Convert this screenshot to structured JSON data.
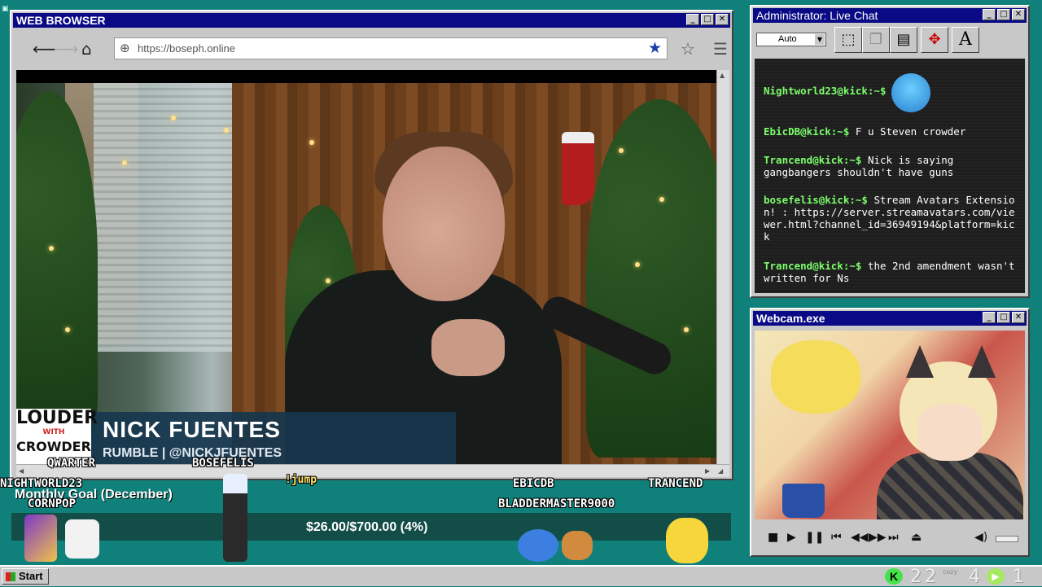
{
  "browser": {
    "title": "WEB BROWSER",
    "url": "https://boseph.online",
    "window_buttons": [
      "_",
      "□",
      "✕"
    ]
  },
  "video": {
    "lower_third_logo": "LOUDER",
    "lower_third_logo_sub": "WITH",
    "lower_third_logo_line2": "CROWDER",
    "name": "NICK FUENTES",
    "sub": "RUMBLE | @NICKJFUENTES"
  },
  "overlay": {
    "avatars": [
      "QWARTER",
      "BOSEFELIS",
      "NIGHTWORLD23",
      "CORNPOP",
      "EBICDB",
      "BLADDERMASTER9000",
      "TRANCEND"
    ],
    "jump_label": "!jump",
    "goal_title": "Monthly Goal (December)",
    "goal_text": "$26.00/$700.00 (4%)",
    "goal_progress": 0.04
  },
  "chat": {
    "title": "Administrator: Live Chat",
    "zoom_select": "Auto",
    "toolbar_font_icon": "A",
    "messages": [
      {
        "user": "Nightworld23@kick:~$",
        "text": ""
      },
      {
        "user": "EbicDB@kick:~$",
        "text": "F u Steven crowder"
      },
      {
        "user": "Trancend@kick:~$",
        "text": "Nick is saying gangbangers shouldn't have guns"
      },
      {
        "user": "bosefelis@kick:~$",
        "text": "Stream Avatars Extension! : https://server.streamavatars.com/viewer.html?channel_id=36949194&platform=kick"
      },
      {
        "user": "Trancend@kick:~$",
        "text": "the 2nd amendment wasn't written for Ns"
      }
    ]
  },
  "webcam": {
    "title": "Webcam.exe"
  },
  "taskbar": {
    "start_label": "Start",
    "tray_numbers": [
      "2",
      "2",
      "4",
      "1"
    ],
    "tray_badge": "cozy"
  },
  "colors": {
    "desktop": "#10807b",
    "titlebar": "#0a0a86",
    "chat_user": "#7cff6b"
  }
}
